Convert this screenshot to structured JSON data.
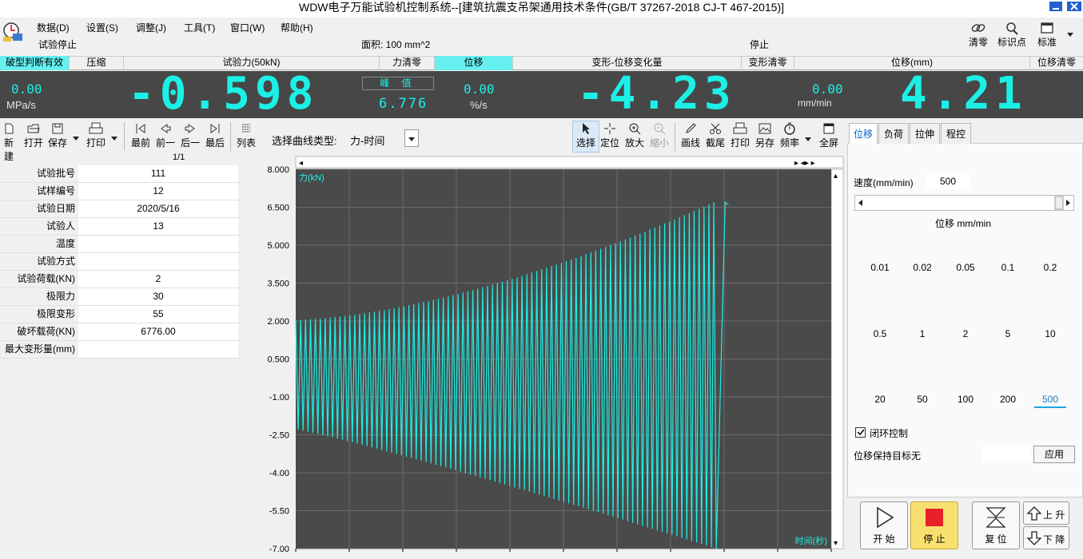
{
  "window": {
    "title": "WDW电子万能试验机控制系统--[建筑抗震支吊架通用技术条件(GB/T 37267-2018 CJ-T 467-2015)]"
  },
  "menu": {
    "items": [
      "数据(D)",
      "设置(S)",
      "调整(J)",
      "工具(T)",
      "窗口(W)",
      "帮助(H)"
    ]
  },
  "status": {
    "left": "试验停止",
    "area": "面积: 100 mm^2",
    "right": "停止"
  },
  "right_tools": {
    "clear": "清零",
    "mark": "标识点",
    "standard": "标准"
  },
  "channels": {
    "break_check": "破型判断有效",
    "compress": "压缩",
    "force": "试验力(50kN)",
    "force_zero": "力清零",
    "displacement_tab": "位移",
    "deform": "变形-位移变化量",
    "deform_zero": "变形清零",
    "disp_mm": "位移(mm)",
    "disp_zero": "位移清零"
  },
  "display": {
    "force_rate": "0.00",
    "force_rate_unit": "MPa/s",
    "force_value": "-0.598",
    "peak_label": "峰 值",
    "peak_value": "6.776",
    "deform_rate": "0.00",
    "deform_rate_unit": "%/s",
    "deform_value": "-4.23",
    "disp_rate": "0.00",
    "disp_rate_unit": "mm/min",
    "disp_value": "4.21"
  },
  "toolbar_left": {
    "new": "新建",
    "open": "打开",
    "save": "保存",
    "print": "打印",
    "first": "最前",
    "prev": "前一",
    "next": "后一",
    "last": "最后",
    "list": "列表",
    "page": "1/1"
  },
  "curve": {
    "label": "选择曲线类型:",
    "value": "力-时间"
  },
  "toolbar_right": {
    "select": "选择",
    "locate": "定位",
    "zoom_in": "放大",
    "zoom_out": "缩小",
    "draw": "画线",
    "cut": "截尾",
    "print": "打印",
    "save_as": "另存",
    "freq": "频率",
    "fullscreen": "全屏"
  },
  "form": [
    {
      "label": "试验批号",
      "value": "111"
    },
    {
      "label": "试样编号",
      "value": "12"
    },
    {
      "label": "试验日期",
      "value": "2020/5/16"
    },
    {
      "label": "试验人",
      "value": "13"
    },
    {
      "label": "温度",
      "value": ""
    },
    {
      "label": "试验方式",
      "value": ""
    },
    {
      "label": "试验荷载(KN)",
      "value": "2"
    },
    {
      "label": "极限力",
      "value": "30"
    },
    {
      "label": "极限变形",
      "value": "55"
    },
    {
      "label": "破坏载荷(KN)",
      "value": "6776.00"
    },
    {
      "label": "最大变形量(mm)",
      "value": ""
    }
  ],
  "chart_data": {
    "type": "line",
    "ylabel": "力(kN)",
    "xlabel": "时间(秒)",
    "ylim": [
      -7.0,
      8.0
    ],
    "y_ticks": [
      "8.000",
      "6.500",
      "5.000",
      "3.500",
      "2.000",
      "0.500",
      "-1.00",
      "-2.50",
      "-4.00",
      "-5.50",
      "-7.00"
    ],
    "cycles": 86,
    "series": [
      {
        "name": "",
        "color": "#1cf0e6",
        "peak_start": 2.05,
        "peak_end": 6.7,
        "valley_start": -2.3,
        "valley_end": -7.0,
        "final_value": 6.6
      }
    ],
    "background": "#4a4a4a"
  },
  "right_panel": {
    "tabs": [
      "位移",
      "负荷",
      "拉伸",
      "程控"
    ],
    "speed_label": "速度(mm/min)",
    "speed_value": "500",
    "unit_label": "位移 mm/min",
    "speeds": [
      "0.01",
      "0.02",
      "0.05",
      "0.1",
      "0.2",
      "0.5",
      "1",
      "2",
      "5",
      "10",
      "20",
      "50",
      "100",
      "200",
      "500"
    ],
    "closed_loop": "闭环控制",
    "hold_label": "位移保持目标无",
    "apply": "应用",
    "start": "开 始",
    "stop": "停 止",
    "reset": "复 位",
    "up": "上 升",
    "down": "下 降"
  },
  "colors": {
    "cyan": "#1cf0e6",
    "display_bg": "#474747",
    "chart_bg": "#4a4a4a",
    "stop_red": "#e8202a"
  }
}
